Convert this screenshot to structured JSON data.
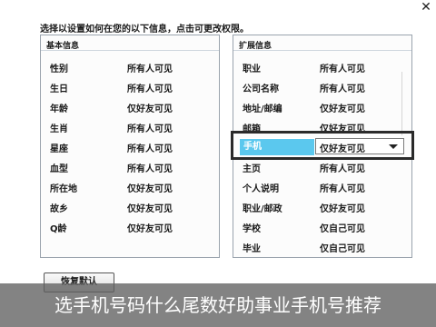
{
  "dialog": {
    "close_glyph": "✕",
    "instruction": "选择以设置如何在您的以下信息，点击可更改权限。",
    "restore_label": "恢复默认"
  },
  "left_panel": {
    "title": "基本信息",
    "rows": [
      {
        "name": "性别",
        "value": "所有人可见"
      },
      {
        "name": "生日",
        "value": "所有人可见"
      },
      {
        "name": "年龄",
        "value": "仅好友可见"
      },
      {
        "name": "生肖",
        "value": "所有人可见"
      },
      {
        "name": "星座",
        "value": "所有人可见"
      },
      {
        "name": "血型",
        "value": "所有人可见"
      },
      {
        "name": "所在地",
        "value": "仅好友可见"
      },
      {
        "name": "故乡",
        "value": "仅好友可见"
      },
      {
        "name": "Q龄",
        "value": "仅好友可见"
      }
    ]
  },
  "right_panel": {
    "title": "扩展信息",
    "rows": [
      {
        "name": "职业",
        "value": "所有人可见"
      },
      {
        "name": "公司名称",
        "value": "所有人可见"
      },
      {
        "name": "地址/邮编",
        "value": "仅好友可见"
      },
      {
        "name": "邮箱",
        "value": "仅好友可见"
      },
      {
        "name": "手机",
        "value": "仅好友可见",
        "selected": true
      },
      {
        "name": "主页",
        "value": "所有人可见"
      },
      {
        "name": "个人说明",
        "value": "所有人可见"
      },
      {
        "name": "职业/邮政",
        "value": "仅好友可见"
      },
      {
        "name": "学校",
        "value": "仅自己可见"
      },
      {
        "name": "毕业",
        "value": "仅自己可见"
      }
    ]
  },
  "caption": "选手机号码什么尾数好助事业手机号推荐"
}
